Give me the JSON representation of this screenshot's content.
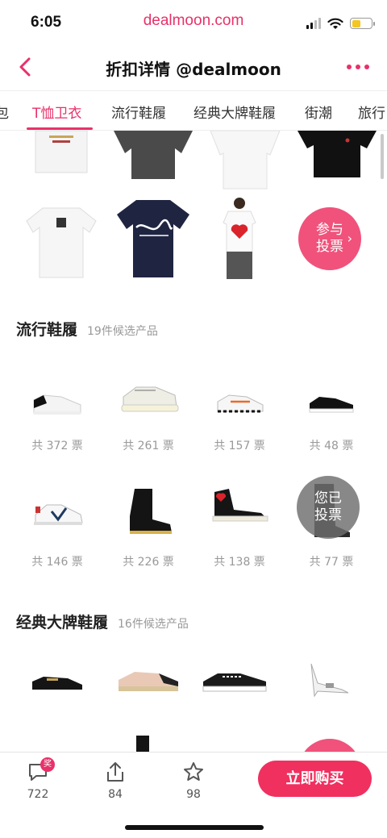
{
  "status_bar": {
    "time": "6:05",
    "url": "dealmoon.com"
  },
  "nav": {
    "title": "折扣详情 @dealmoon"
  },
  "tabs": [
    {
      "label": "包"
    },
    {
      "label": "T恤卫衣"
    },
    {
      "label": "流行鞋履"
    },
    {
      "label": "经典大牌鞋履"
    },
    {
      "label": "街潮"
    },
    {
      "label": "旅行"
    }
  ],
  "tshirt_section": {
    "vote_button": {
      "line1": "参与",
      "line2": "投票"
    }
  },
  "sneakers_section": {
    "title": "流行鞋履",
    "subtitle": "19件候选产品",
    "items": [
      {
        "count": "共 372 票"
      },
      {
        "count": "共 261 票"
      },
      {
        "count": "共 157 票"
      },
      {
        "count": "共 48 票"
      },
      {
        "count": "共 146 票"
      },
      {
        "count": "共 226 票"
      },
      {
        "count": "共 138 票"
      },
      {
        "count": "共 77 票"
      }
    ],
    "voted_badge": {
      "line1": "您已",
      "line2": "投票"
    }
  },
  "classic_section": {
    "title": "经典大牌鞋履",
    "subtitle": "16件候选产品"
  },
  "bottom_bar": {
    "comments": "722",
    "comments_badge": "奖",
    "shares": "84",
    "favorites": "98",
    "buy_label": "立即购买"
  },
  "colors": {
    "accent": "#e8316a",
    "button": "#f0305f"
  }
}
